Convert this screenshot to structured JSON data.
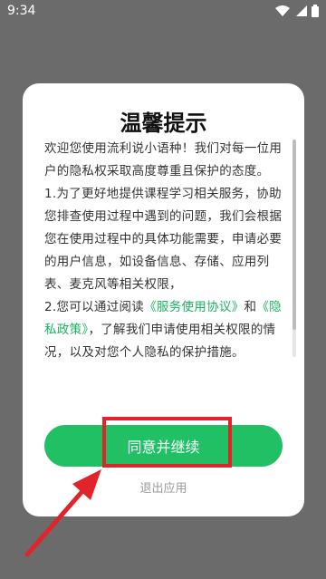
{
  "status_bar": {
    "time": "9:34",
    "icons": [
      "wifi-icon",
      "signal-icon",
      "battery-icon"
    ]
  },
  "dialog": {
    "title": "温馨提示",
    "body": {
      "p1": "欢迎您使用流利说小语种！我们对每一位用户的隐私权采取高度尊重且保护的态度。",
      "p2": "1.为了更好地提供课程学习相关服务，协助您排查使用过程中遇到的问题，我们会根据您在使用过程中的具体功能需要，申请必要的用户信息，如设备信息、存储、应用列表、麦克风等相关权限，",
      "p3_a": "2.您可以通过阅读",
      "p3_link1": "《服务使用协议》",
      "p3_b": "和",
      "p3_link2": "《隐私政策》",
      "p3_c": "，了解我们申请使用相关权限的情况，以及对您个人隐私的保护措施。"
    },
    "agree_label": "同意并继续",
    "exit_label": "退出应用"
  },
  "colors": {
    "accent": "#21c065",
    "link": "#19b261",
    "annotation": "#e0242a",
    "overlay": "#6b6b6b"
  }
}
